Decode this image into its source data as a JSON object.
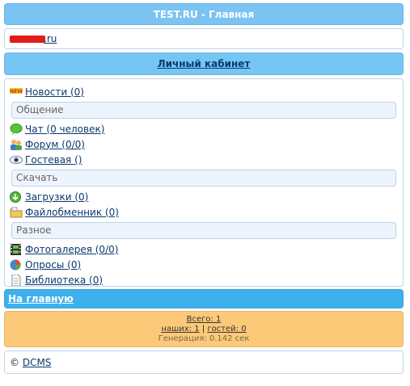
{
  "header": {
    "title": "TEST.RU - Главная"
  },
  "site": {
    "link_suffix": ".ru"
  },
  "cabinet": {
    "label": "Личный кабинет"
  },
  "menu": {
    "news": {
      "label": "Новости (0)",
      "icon": "new-badge-icon"
    },
    "section_communication": "Общение",
    "chat": {
      "label": "Чат (0 человек)",
      "icon": "chat-bubble-icon"
    },
    "forum": {
      "label": "Форум (0/0)",
      "icon": "forum-users-icon"
    },
    "guestbook": {
      "label": "Гостевая ()",
      "icon": "eye-icon"
    },
    "section_download": "Скачать",
    "downloads": {
      "label": "Загрузки (0)",
      "icon": "download-arrow-icon"
    },
    "fileshare": {
      "label": "Файлобменник (0)",
      "icon": "folder-icon"
    },
    "section_misc": "Разное",
    "gallery": {
      "label": "Фотогалерея (0/0)",
      "icon": "film-icon"
    },
    "polls": {
      "label": "Опросы (0)",
      "icon": "pie-chart-icon"
    },
    "library": {
      "label": "Библиотека (0)",
      "icon": "document-icon"
    }
  },
  "nav": {
    "home_label": "На главную"
  },
  "stats": {
    "total": "Всего: 1",
    "ours": "наших: 1",
    "separator": "|",
    "guests": "гостей: 0",
    "generation": "Генерация: 0.142 сек"
  },
  "footer": {
    "copyright": "©",
    "brand": "DCMS"
  },
  "colors": {
    "title_bg": "#7ac3f2",
    "cabinet_bg": "#75c6f4",
    "home_bg": "#3fb0ee",
    "stats_bg": "#fcc978"
  }
}
